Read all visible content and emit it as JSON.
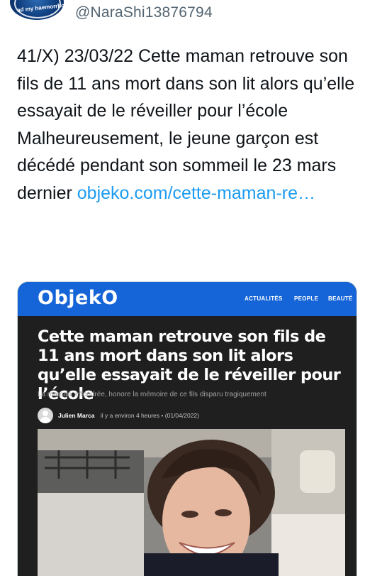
{
  "tweet": {
    "handle": "@NaraShi13876794",
    "avatar_text": "ad my haemorrhoid",
    "text": "41/X) 23/03/22 Cette maman retrouve son fils de 11 ans mort dans son lit alors qu’elle essayait de le réveiller pour l’école Malheureusement, le jeune garçon est décédé pendant son sommeil le 23 mars dernier ",
    "link": "objeko.com/cette-maman-re…"
  },
  "card": {
    "logo": "ObjekO",
    "nav": [
      "ACTUALITÉS",
      "PEOPLE",
      "BEAUTÉ"
    ],
    "headline": "Cette maman retrouve son fils de 11 ans mort dans son lit alors qu’elle essayait de le réveiller pour l’école",
    "subtitle": "La maman, effondrée, honore la mémoire de ce fils disparu tragiquement",
    "author": "Julien Marca",
    "time": "il y a environ 4 heures",
    "separator": "•",
    "date": "(01/04/2022)"
  },
  "colors": {
    "link": "#1d9bf0",
    "header_blue": "#1565d8",
    "card_dark": "#1f1f1f"
  }
}
